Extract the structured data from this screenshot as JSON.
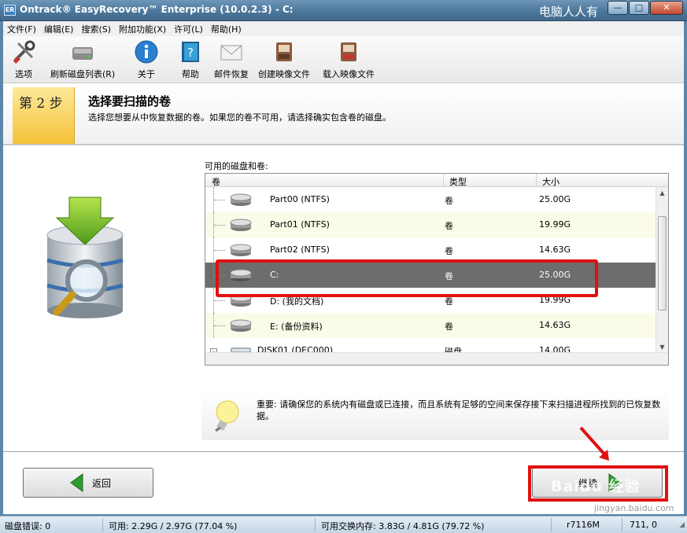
{
  "window": {
    "title": "Ontrack® EasyRecovery™ Enterprise (10.0.2.3) - C:",
    "app_icon_text": "ER",
    "watermark": "电脑人人有",
    "minimize": "—",
    "maximize": "□",
    "close": "✕"
  },
  "menu": [
    "文件(F)",
    "编辑(E)",
    "搜索(S)",
    "附加功能(X)",
    "许可(L)",
    "帮助(H)"
  ],
  "toolbar": [
    {
      "label": "选项",
      "icon": "tools-icon"
    },
    {
      "label": "刷新磁盘列表(R)",
      "icon": "drive-refresh-icon"
    },
    {
      "label": "关于",
      "icon": "info-icon"
    },
    {
      "label": "帮助",
      "icon": "help-book-icon"
    },
    {
      "label": "邮件恢复",
      "icon": "envelope-icon"
    },
    {
      "label": "创建映像文件",
      "icon": "create-image-icon"
    },
    {
      "label": "载入映像文件",
      "icon": "load-image-icon"
    }
  ],
  "step": {
    "label": "第 2 步",
    "title": "选择要扫描的卷",
    "description": "选择您想要从中恢复数据的卷。如果您的卷不可用，请选择确实包含卷的磁盘。"
  },
  "volumes": {
    "label": "可用的磁盘和卷:",
    "columns": [
      "卷",
      "类型",
      "大小"
    ],
    "rows": [
      {
        "name": "Part00 (NTFS)",
        "type": "卷",
        "size": "25.00G",
        "selected": false
      },
      {
        "name": "Part01 (NTFS)",
        "type": "卷",
        "size": "19.99G",
        "selected": false
      },
      {
        "name": "Part02 (NTFS)",
        "type": "卷",
        "size": "14.63G",
        "selected": false
      },
      {
        "name": "C:",
        "type": "卷",
        "size": "25.00G",
        "selected": true
      },
      {
        "name": "D: (我的文档)",
        "type": "卷",
        "size": "19.99G",
        "selected": false
      },
      {
        "name": "E: (备份资料)",
        "type": "卷",
        "size": "14.63G",
        "selected": false
      },
      {
        "name": "DISK01 (DEC000)",
        "type": "磁盘",
        "size": "14.00G",
        "selected": false
      }
    ]
  },
  "notice": {
    "text": "重要: 请确保您的系统内有磁盘或已连接，而且系统有足够的空间来保存接下来扫描进程所找到的已恢复数据。"
  },
  "buttons": {
    "back": "返回",
    "next": "继续"
  },
  "overlay": {
    "baidu": "Baidu 经验",
    "baidu_sub": "jingyan.baidu.com"
  },
  "status": {
    "disk_errors": "磁盘错误: 0",
    "available": "可用: 2.29G / 2.97G (77.04 %)",
    "swap": "可用交换内存: 3.83G / 4.81G (79.72 %)",
    "build": "r7116M",
    "coords": "711, 0"
  },
  "colors": {
    "selected_row": "#6d6d6d",
    "highlight_red": "#e01010",
    "step_yellow": "#f5c23a",
    "alt_row": "#fbfbe9"
  }
}
